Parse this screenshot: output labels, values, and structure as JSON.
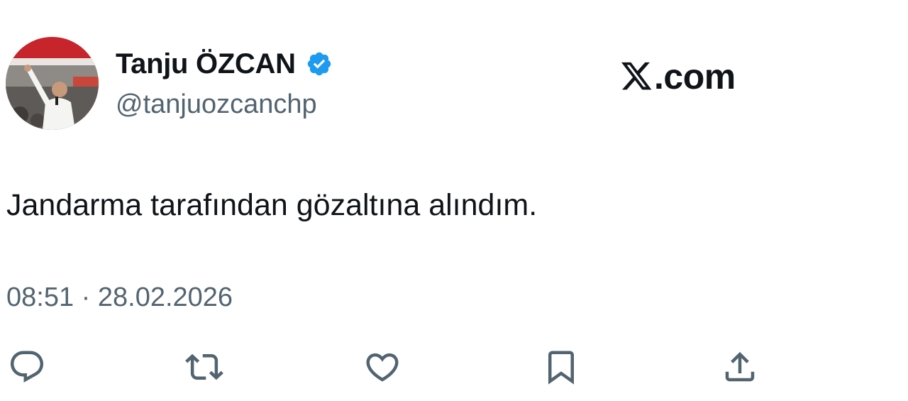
{
  "author": {
    "display_name": "Tanju ÖZCAN",
    "handle": "@tanjuozcanchp",
    "verified_icon": "verified-badge-icon",
    "verified_color": "#1d9bf0"
  },
  "brand": {
    "text": ".com",
    "logo_icon": "x-logo-icon"
  },
  "tweet": {
    "text": "Jandarma tarafından gözaltına alındım.",
    "timestamp": "08:51 · 28.02.2026"
  },
  "actions": [
    {
      "name": "reply",
      "icon": "reply-icon"
    },
    {
      "name": "retweet",
      "icon": "retweet-icon"
    },
    {
      "name": "like",
      "icon": "heart-icon"
    },
    {
      "name": "bookmark",
      "icon": "bookmark-icon"
    },
    {
      "name": "share",
      "icon": "share-icon"
    }
  ],
  "colors": {
    "text_primary": "#0f1419",
    "text_secondary": "#536471",
    "icon_gray": "#536471",
    "background": "#ffffff"
  }
}
